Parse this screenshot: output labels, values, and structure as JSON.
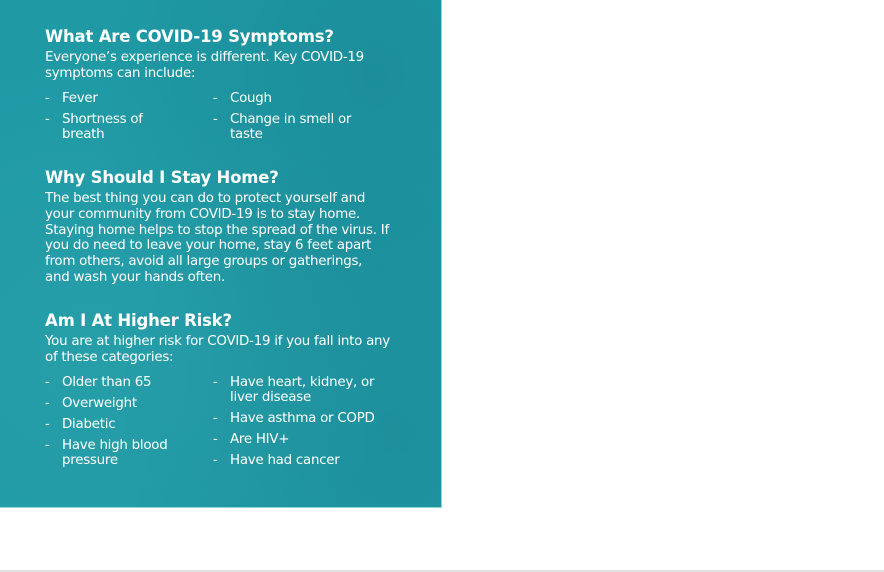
{
  "symptoms": {
    "heading": "What Are COVID-19 Symptoms?",
    "intro": "Everyone’s experience is different. Key COVID-19 symptoms can include:",
    "bullet": "-",
    "left_items": [
      "Fever",
      "Shortness of breath"
    ],
    "right_items": [
      "Cough",
      "Change in smell or taste"
    ]
  },
  "stay_home": {
    "heading": "Why Should I Stay Home?",
    "body": "The best thing you can do to protect yourself and your community from COVID-19 is to stay home. Staying home helps to stop the spread of the virus. If you do need to leave your home, stay 6 feet apart from others, avoid all large groups or gatherings, and wash your hands often."
  },
  "risk": {
    "heading": "Am I At Higher Risk?",
    "intro": "You are at higher risk for COVID-19 if you fall into any of these categories:",
    "bullet": "-",
    "left_items": [
      "Older than 65",
      "Overweight",
      "Diabetic",
      "Have high blood pressure"
    ],
    "right_items": [
      "Have heart, kidney, or liver disease",
      "Have asthma or COPD",
      "Are HIV+",
      "Have had cancer"
    ]
  },
  "colors": {
    "panel_background": "#1f9aa5",
    "panel_edge": "#8fd6dc",
    "text": "#ffffff",
    "page_background": "#ffffff"
  }
}
